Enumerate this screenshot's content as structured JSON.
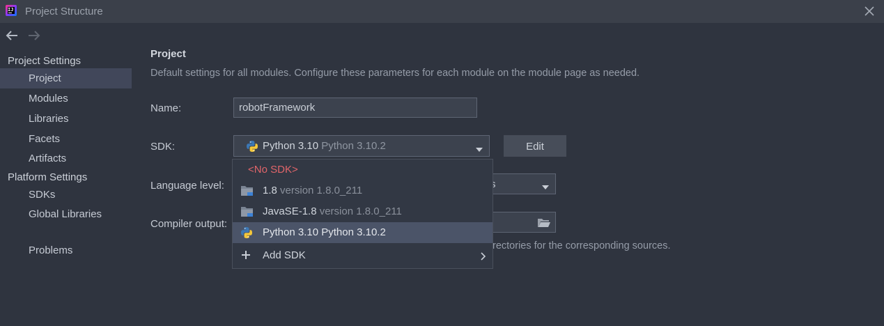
{
  "window": {
    "title": "Project Structure"
  },
  "sidebar": {
    "project_settings_header": "Project Settings",
    "project_items": [
      {
        "label": "Project",
        "selected": true
      },
      {
        "label": "Modules"
      },
      {
        "label": "Libraries"
      },
      {
        "label": "Facets"
      },
      {
        "label": "Artifacts"
      }
    ],
    "platform_settings_header": "Platform Settings",
    "platform_items": [
      {
        "label": "SDKs"
      },
      {
        "label": "Global Libraries"
      }
    ],
    "problems_label": "Problems"
  },
  "main": {
    "title": "Project",
    "description": "Default settings for all modules. Configure these parameters for each module on the module page as needed.",
    "name_label": "Name:",
    "name_value": "robotFramework",
    "sdk_label": "SDK:",
    "sdk_selected_name": "Python 3.10",
    "sdk_selected_version": "Python 3.10.2",
    "edit_label": "Edit",
    "language_level_label": "Language level:",
    "language_level_partial": "s",
    "compiler_output_label": "Compiler output:",
    "compiler_hint_partial": "rectories for the corresponding sources."
  },
  "sdk_dropdown": {
    "no_sdk": "<No SDK>",
    "items": [
      {
        "name": "1.8",
        "detail": "version 1.8.0_211",
        "icon": "folder-icon"
      },
      {
        "name": "JavaSE-1.8",
        "detail": "version 1.8.0_211",
        "icon": "folder-icon"
      },
      {
        "name": "Python 3.10",
        "detail": "Python 3.10.2",
        "icon": "python-icon",
        "selected": true
      }
    ],
    "add_sdk": "Add SDK"
  },
  "colors": {
    "background": "#2f343f",
    "selection": "#41475a",
    "popup_selection": "#4b5468",
    "no_sdk_text": "#e0656a"
  }
}
